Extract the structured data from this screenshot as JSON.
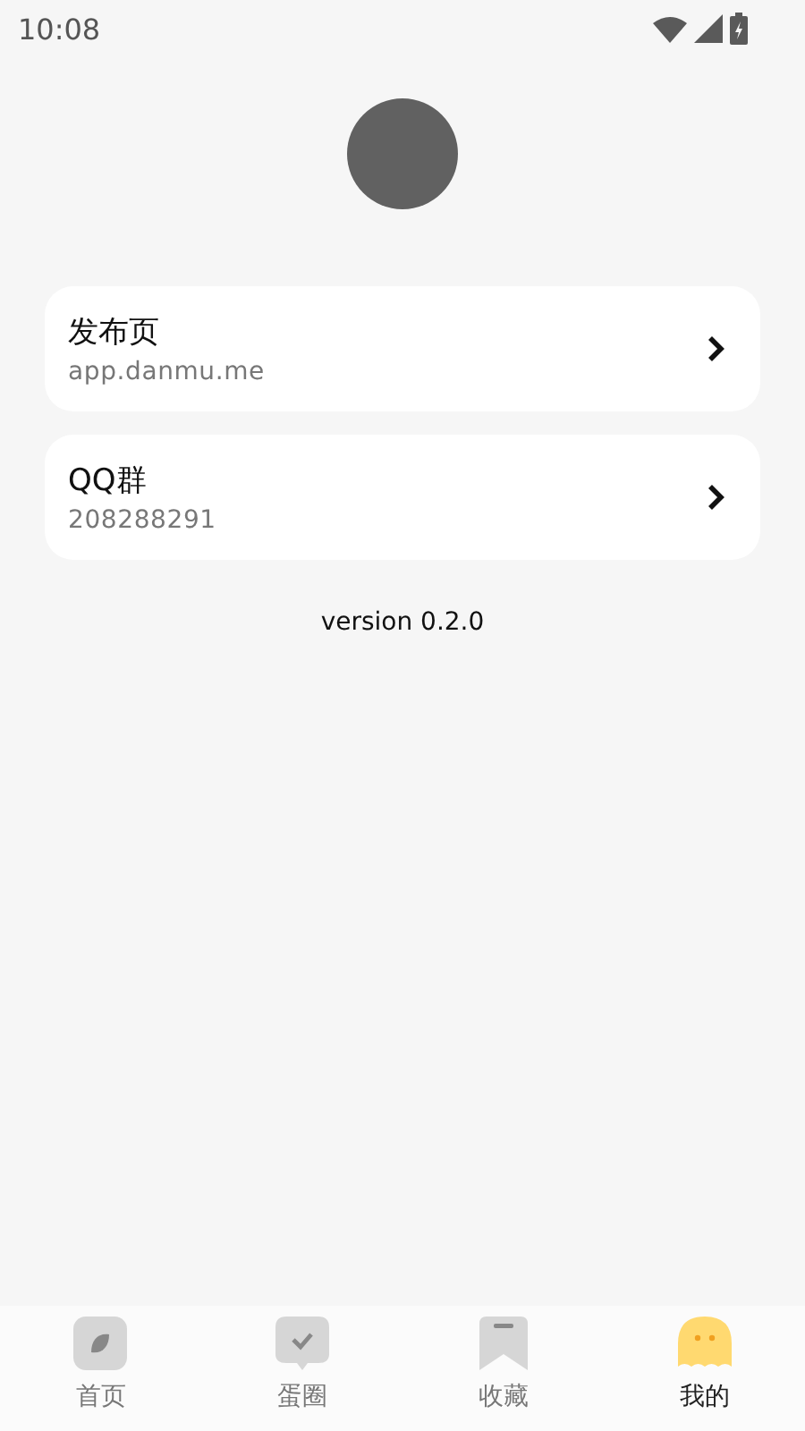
{
  "status_bar": {
    "time": "10:08"
  },
  "links": [
    {
      "title": "发布页",
      "subtitle": "app.danmu.me"
    },
    {
      "title": "QQ群",
      "subtitle": "208288291"
    }
  ],
  "version": "version 0.2.0",
  "tabs": [
    {
      "label": "首页",
      "kind": "leaf",
      "selected": false
    },
    {
      "label": "蛋圈",
      "kind": "bubble",
      "selected": false
    },
    {
      "label": "收藏",
      "kind": "bookmark",
      "selected": false
    },
    {
      "label": "我的",
      "kind": "ghost",
      "selected": true
    }
  ]
}
